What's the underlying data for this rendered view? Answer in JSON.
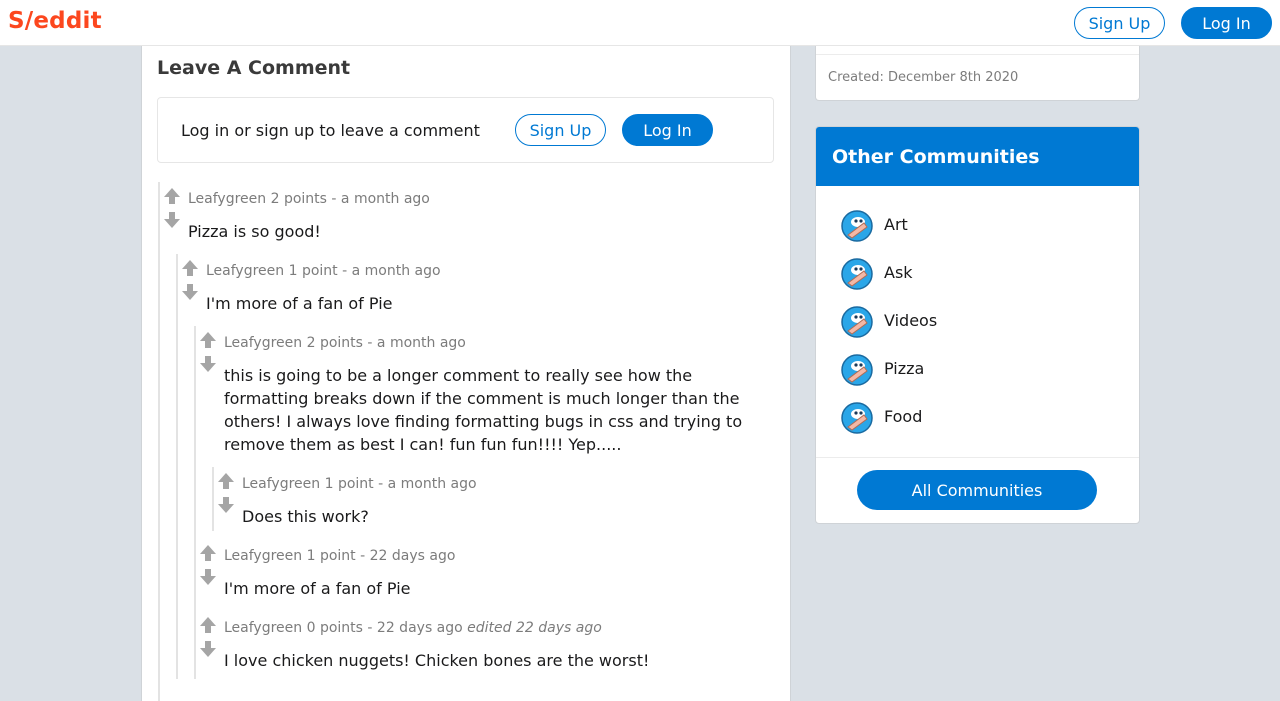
{
  "header": {
    "logo": "S/eddit",
    "sign_up": "Sign Up",
    "log_in": "Log In"
  },
  "main": {
    "section_title": "Leave A Comment",
    "login_prompt": "Log in or sign up to leave a comment",
    "sign_up": "Sign Up",
    "log_in": "Log In"
  },
  "comments": [
    {
      "author": "Leafygreen",
      "points": "2 points",
      "age": "a month ago",
      "edited": "",
      "text": "Pizza is so good!"
    },
    {
      "author": "Leafygreen",
      "points": "1 point",
      "age": "a month ago",
      "edited": "",
      "text": "I'm more of a fan of Pie"
    },
    {
      "author": "Leafygreen",
      "points": "2 points",
      "age": "a month ago",
      "edited": "",
      "text": "this is going to be a longer comment to really see how the formatting breaks down if the comment is much longer than the others! I always love finding formatting bugs in css and trying to remove them as best I can! fun fun fun!!!! Yep....."
    },
    {
      "author": "Leafygreen",
      "points": "1 point",
      "age": "a month ago",
      "edited": "",
      "text": "Does this work?"
    },
    {
      "author": "Leafygreen",
      "points": "1 point",
      "age": "22 days ago",
      "edited": "",
      "text": "I'm more of a fan of Pie"
    },
    {
      "author": "Leafygreen",
      "points": "0 points",
      "age": "22 days ago",
      "edited": "edited 22 days ago",
      "text": "I love chicken nuggets! Chicken bones are the worst!"
    }
  ],
  "sidebar": {
    "created": "Created: December 8th 2020",
    "communities_title": "Other Communities",
    "communities": [
      "Art",
      "Ask",
      "Videos",
      "Pizza",
      "Food"
    ],
    "all_button": "All Communities"
  },
  "colors": {
    "brand": "#fc471e",
    "accent": "#0079d3",
    "background": "#dae0e6"
  },
  "icons": {
    "upvote": "arrow-up-icon",
    "downvote": "arrow-down-icon",
    "community": "community-avatar-icon"
  }
}
